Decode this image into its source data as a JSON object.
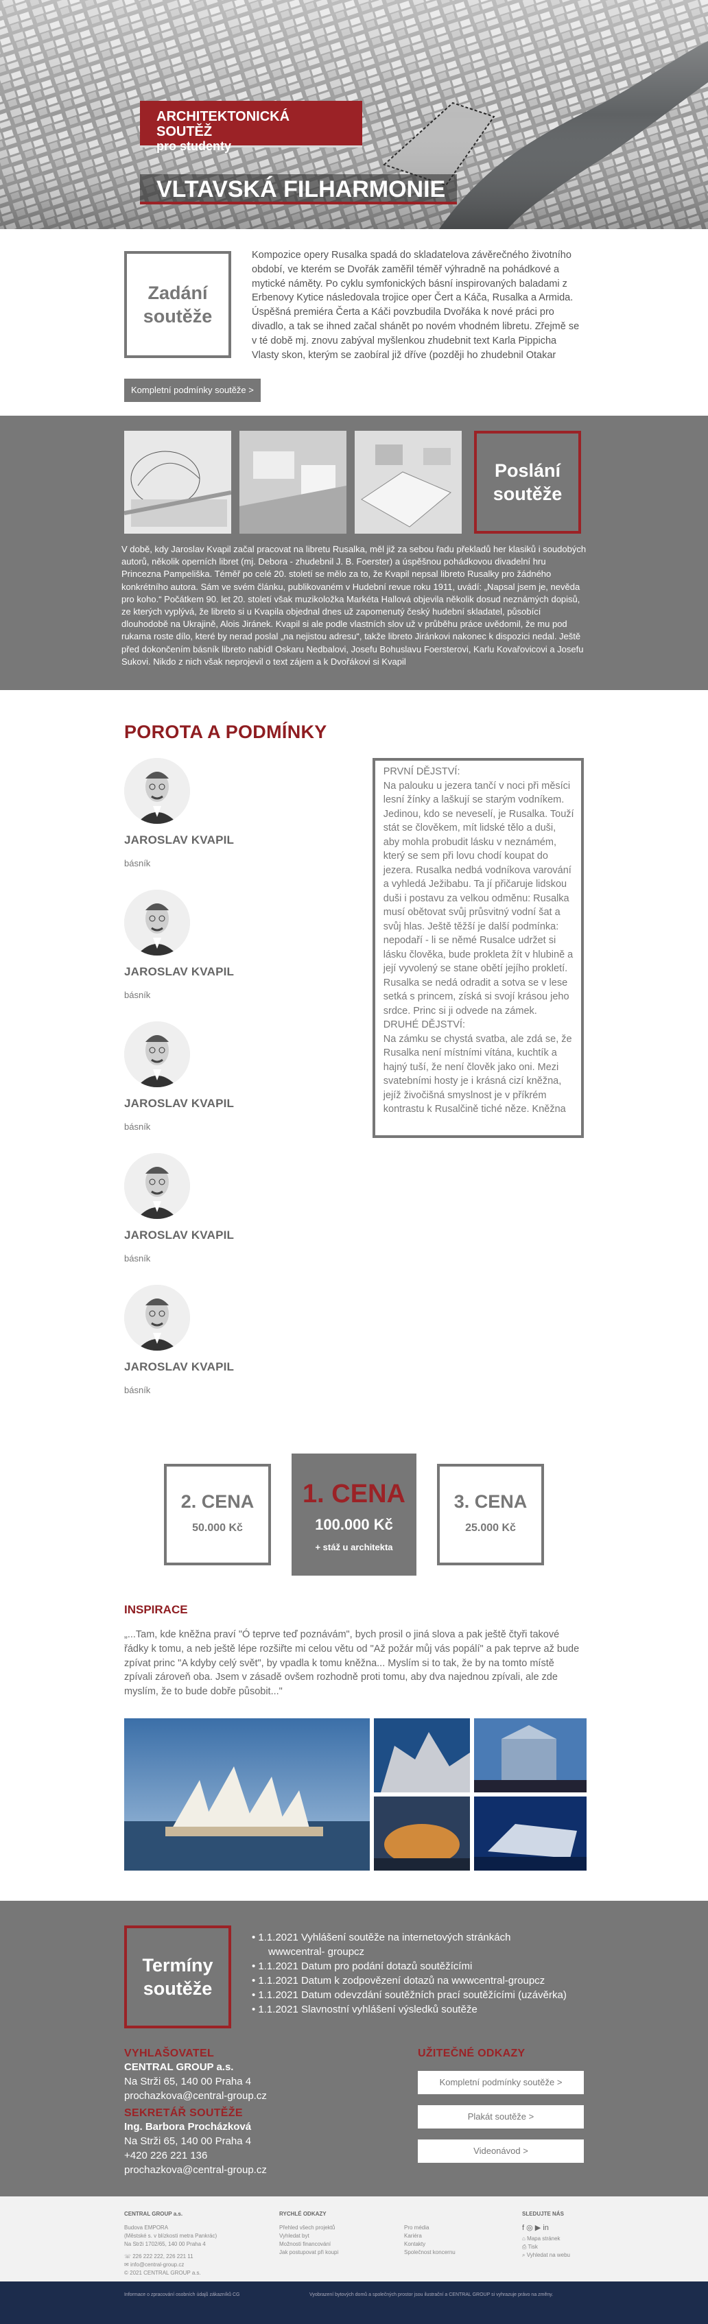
{
  "hero": {
    "tag_line1": "ARCHITEKTONICKÁ SOUTĚŽ",
    "tag_line2": "pro studenty",
    "title": "VLTAVSKÁ FILHARMONIE"
  },
  "zadani": {
    "title": "Zadání soutěže",
    "text": "Kompozice opery Rusalka spadá do skladatelova závěrečného životního období, ve kterém se Dvořák zaměřil téměř výhradně na pohádkové a mytické náměty. Po cyklu symfonických básní inspirovaných baladami z Erbenovy Kytice následovala trojice oper Čert a Káča, Rusalka a Armida. Úspěšná premiéra Čerta a Káči povzbudila Dvořáka k nové práci pro divadlo, a tak se ihned začal shánět po novém vhodném libretu. Zřejmě se v té době mj. znovu zabýval myšlenkou zhudebnit text Karla Pippicha Vlasty skon, kterým se zaobíral již dříve (později ho zhudebnil Otakar Ostrčil). Svoji",
    "button": "Kompletní podmínky soutěže  >"
  },
  "poslani": {
    "title": "Poslání soutěže",
    "text": "V době, kdy Jaroslav Kvapil začal pracovat na libretu Rusalka, měl již za sebou řadu překladů her klasiků i soudobých autorů, několik operních libret (mj. Debora - zhudebnil J. B. Foerster) a úspěšnou pohádkovou divadelní hru Princezna Pampeliška. Téměř po celé 20. století se mělo za to, že Kvapil nepsal libreto Rusalky pro žádného konkrétního autora. Sám ve svém článku, publikovaném v Hudební revue roku 1911, uvádí: „Napsal jsem je, nevěda pro koho.“ Počátkem 90. let 20. století však muzikoložka Markéta Hallová objevila několik dosud neznámých dopisů, ze kterých vyplývá, že libreto si u Kvapila objednal dnes už zapomenutý český hudební skladatel, působící dlouhodobě na Ukrajině, Alois Jiránek. Kvapil si ale podle vlastních slov už v průběhu práce uvědomil, že mu pod rukama roste dílo, které by nerad poslal „na nejistou adresu“, takže libreto Jiránkovi nakonec k dispozici nedal. Ještě před dokončením básník libreto nabídl Oskaru Nedbalovi, Josefu Bohuslavu Foersterovi, Karlu Kovařovicovi a Josefu Sukovi. Nikdo z nich však neprojevil o text zájem a k Dvořákovi si Kvapil"
  },
  "porota": {
    "heading": "POROTA A PODMÍNKY",
    "members": [
      {
        "name": "JAROSLAV KVAPIL",
        "role": "básník"
      },
      {
        "name": "JAROSLAV KVAPIL",
        "role": "básník"
      },
      {
        "name": "JAROSLAV KVAPIL",
        "role": "básník"
      },
      {
        "name": "JAROSLAV KVAPIL",
        "role": "básník"
      },
      {
        "name": "JAROSLAV KVAPIL",
        "role": "básník"
      }
    ],
    "card_text": "PRVNÍ DĚJSTVÍ:\nNa palouku u jezera tančí v noci při měsíci lesní žínky a laškují se starým vodníkem. Jedinou, kdo se neveselí, je Rusalka. Touží stát se člověkem, mít lidské tělo a duši, aby mohla probudit lásku v neznámém, který se sem při lovu chodí koupat do jezera. Rusalka nedbá vodníkova varování a vyhledá Ježibabu. Ta jí přičaruje lidskou duši i postavu za velkou odměnu: Rusalka musí obětovat svůj průsvitný vodní šat a svůj hlas. Ještě těžší je další podmínka: nepodaří - li se němé Rusalce udržet si lásku člověka, bude prokleta žít v hlubině a její vyvolený se stane obětí jejího prokletí. Rusalka se nedá odradit a sotva se v lese setká s princem, získá si svojí krásou jeho srdce. Princ si ji odvede na zámek.\nDRUHÉ DĚJSTVÍ:\nNa zámku se chystá svatba, ale zdá se, že Rusalka není místními vítána, kuchtík a hajný tuší, že není člověk jako oni. Mezi svatebními hosty je i krásná cizí kněžna, jejíž živočišná smyslnost je v příkrém kontrastu k Rusalčině tiché něze. Kněžna"
  },
  "prizes": {
    "second": {
      "title": "2. CENA",
      "value": "50.000 Kč"
    },
    "first": {
      "title": "1. CENA",
      "value": "100.000 Kč",
      "extra": "+ stáž u architekta"
    },
    "third": {
      "title": "3. CENA",
      "value": "25.000 Kč"
    }
  },
  "inspirace": {
    "heading": "INSPIRACE",
    "text": "„...Tam, kde kněžna praví \"Ó teprve teď poznávám\", bych prosil o jiná slova a pak ještě čtyři takové řádky k tomu, a neb ještě lépe rozšiřte mi celou větu od \"Až požár můj vás popálí\" a pak teprve až bude zpívat princ \"A kdyby celý svět\", by vpadla k tomu kněžna... Myslím si to tak, že by na tomto místě zpívali zároveň oba. Jsem v zásadě ovšem rozhodně proti tomu, aby dva najednou zpívali, ale zde myslím, že to bude dobře působit...\""
  },
  "terminy": {
    "title": "Termíny soutěže",
    "dates": [
      "• 1.1.2021 Vyhlášení soutěže na internetových stránkách",
      "wwwcentral- groupcz",
      "• 1.1.2021 Datum pro podání dotazů soutěžícími",
      "• 1.1.2021 Datum k zodpovězení dotazů na wwwcentral-groupcz",
      "• 1.1.2021 Datum odevzdání soutěžních prací soutěžícími (uzávěrka)",
      "• 1.1.2021 Slavnostní vyhlášení výsledků soutěže"
    ],
    "vyhlasovatel": {
      "heading": "VYHLAŠOVATEL",
      "name": "CENTRAL GROUP a.s.",
      "address": "Na Strži 65, 140 00 Praha 4",
      "email": "prochazkova@central-group.cz"
    },
    "sekretar": {
      "heading": "SEKRETÁŘ SOUTĚŽE",
      "name": "Ing. Barbora Procházková",
      "address": "Na Strži 65, 140 00 Praha 4",
      "phone": "+420 226 221 136",
      "email": "prochazkova@central-group.cz"
    },
    "links_heading": "UŽITEČNÉ ODKAZY",
    "links": [
      "Kompletní podmínky soutěže  >",
      "Plakát soutěže  >",
      "Videonávod  >"
    ]
  },
  "footer": {
    "company": "CENTRAL GROUP a.s.",
    "addr1": "Budova EMPORA",
    "addr2": "(Městské s. v blízkosti metra Pankrác)",
    "addr3": "Na Strži 1702/65, 140 00 Praha 4",
    "phone": "226 222 222, 226 221 11",
    "email": "info@central-group.cz",
    "copyright": "© 2021 CENTRAL GROUP a.s.",
    "rychle": "RYCHLÉ ODKAZY",
    "rl1": [
      "Přehled všech projektů",
      "Vyhledat byt",
      "Možnosti financování",
      "Jak postupovat při koupi"
    ],
    "rl2": [
      "Pro média",
      "Kariéra",
      "Kontakty",
      "Společnost koncernu"
    ],
    "sledujte": "SLEDUJTE NÁS",
    "sl": [
      "Mapa stránek",
      "Tisk",
      "Vyhledat na webu"
    ],
    "bottom_left": "Informace o zpracování osobních údajů zákazníků CG",
    "bottom_right": "Vyobrazení bytových domů a společných prostor jsou ilustrační a CENTRAL GROUP si vyhrazuje právo na změny."
  }
}
